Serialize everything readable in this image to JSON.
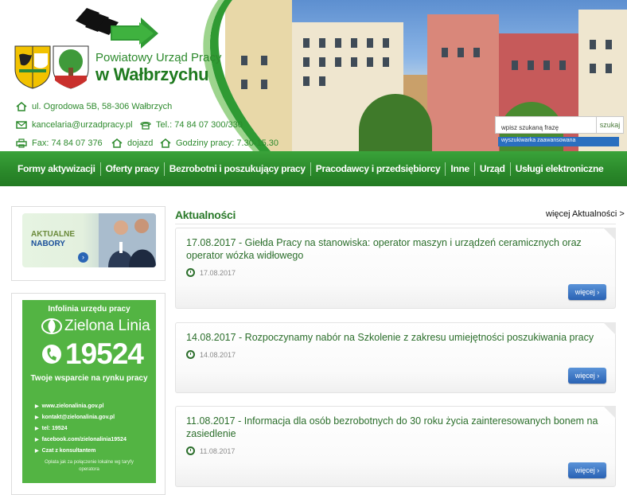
{
  "header": {
    "brand_line1": "Powiatowy Urząd Pracy",
    "brand_line2": "w Wałbrzychu",
    "address": "ul. Ogrodowa 5B, 58-306 Wałbrzych",
    "email": "kancelaria@urzadpracy.pl",
    "phone": "Tel.: 74 84 07 300/330",
    "fax": "Fax: 74 84 07 376",
    "directions": "dojazd",
    "hours": "Godziny pracy: 7.30-15.30",
    "search_placeholder": "wpisz szukaną frazę",
    "search_button": "szukaj",
    "advanced_search": "wyszukiwarka zaawansowana"
  },
  "nav": {
    "items": [
      {
        "label": "Formy aktywizacji"
      },
      {
        "label": "Oferty pracy"
      },
      {
        "label": "Bezrobotni i poszukujący pracy"
      },
      {
        "label": "Pracodawcy i przedsiębiorcy"
      },
      {
        "label": "Inne"
      },
      {
        "label": "Urząd"
      },
      {
        "label": "Usługi elektroniczne"
      }
    ]
  },
  "sidebar": {
    "nabory_line1": "AKTUALNE",
    "nabory_line2": "NABORY",
    "zl_title": "Infolinia urzędu pracy",
    "zl_logo": "Zielona Linia",
    "zl_number": "19524",
    "zl_sub": "Twoje wsparcie na rynku pracy",
    "zl_links": [
      "www.zielonalinia.gov.pl",
      "kontakt@zielonalinia.gov.pl",
      "tel: 19524",
      "facebook.com/zielonalinia19524",
      "Czat z konsultantem"
    ],
    "zl_footer": "Opłata jak za połączenie lokalne wg taryfy operatora"
  },
  "main": {
    "heading": "Aktualności",
    "more_link": "więcej Aktualności",
    "more_button": "więcej",
    "news": [
      {
        "title": "17.08.2017 - Giełda Pracy na stanowiska: operator maszyn i urządzeń ceramicznych oraz operator wózka widłowego",
        "date": "17.08.2017"
      },
      {
        "title": "14.08.2017 - Rozpoczynamy nabór na Szkolenie z zakresu umiejętności poszukiwania pracy",
        "date": "14.08.2017"
      },
      {
        "title": "11.08.2017 - Informacja dla osób bezrobotnych do 30 roku życia zainteresowanych bonem na zasiedlenie",
        "date": "11.08.2017"
      }
    ]
  },
  "colors": {
    "brand_green": "#2b8a2b",
    "link_blue": "#2a62b4",
    "zl_green": "#53b443"
  }
}
